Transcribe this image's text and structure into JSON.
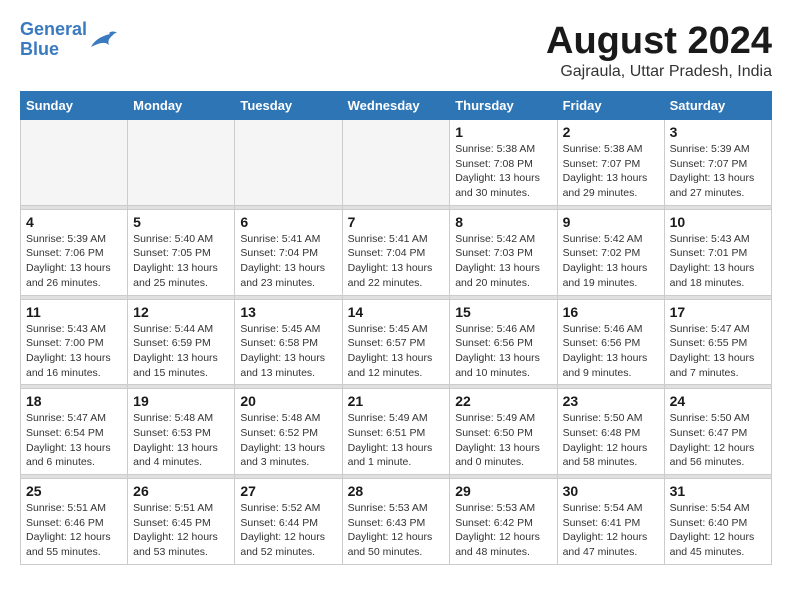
{
  "header": {
    "logo_line1": "General",
    "logo_line2": "Blue",
    "month_year": "August 2024",
    "location": "Gajraula, Uttar Pradesh, India"
  },
  "weekdays": [
    "Sunday",
    "Monday",
    "Tuesday",
    "Wednesday",
    "Thursday",
    "Friday",
    "Saturday"
  ],
  "weeks": [
    [
      {
        "day": "",
        "info": ""
      },
      {
        "day": "",
        "info": ""
      },
      {
        "day": "",
        "info": ""
      },
      {
        "day": "",
        "info": ""
      },
      {
        "day": "1",
        "info": "Sunrise: 5:38 AM\nSunset: 7:08 PM\nDaylight: 13 hours\nand 30 minutes."
      },
      {
        "day": "2",
        "info": "Sunrise: 5:38 AM\nSunset: 7:07 PM\nDaylight: 13 hours\nand 29 minutes."
      },
      {
        "day": "3",
        "info": "Sunrise: 5:39 AM\nSunset: 7:07 PM\nDaylight: 13 hours\nand 27 minutes."
      }
    ],
    [
      {
        "day": "4",
        "info": "Sunrise: 5:39 AM\nSunset: 7:06 PM\nDaylight: 13 hours\nand 26 minutes."
      },
      {
        "day": "5",
        "info": "Sunrise: 5:40 AM\nSunset: 7:05 PM\nDaylight: 13 hours\nand 25 minutes."
      },
      {
        "day": "6",
        "info": "Sunrise: 5:41 AM\nSunset: 7:04 PM\nDaylight: 13 hours\nand 23 minutes."
      },
      {
        "day": "7",
        "info": "Sunrise: 5:41 AM\nSunset: 7:04 PM\nDaylight: 13 hours\nand 22 minutes."
      },
      {
        "day": "8",
        "info": "Sunrise: 5:42 AM\nSunset: 7:03 PM\nDaylight: 13 hours\nand 20 minutes."
      },
      {
        "day": "9",
        "info": "Sunrise: 5:42 AM\nSunset: 7:02 PM\nDaylight: 13 hours\nand 19 minutes."
      },
      {
        "day": "10",
        "info": "Sunrise: 5:43 AM\nSunset: 7:01 PM\nDaylight: 13 hours\nand 18 minutes."
      }
    ],
    [
      {
        "day": "11",
        "info": "Sunrise: 5:43 AM\nSunset: 7:00 PM\nDaylight: 13 hours\nand 16 minutes."
      },
      {
        "day": "12",
        "info": "Sunrise: 5:44 AM\nSunset: 6:59 PM\nDaylight: 13 hours\nand 15 minutes."
      },
      {
        "day": "13",
        "info": "Sunrise: 5:45 AM\nSunset: 6:58 PM\nDaylight: 13 hours\nand 13 minutes."
      },
      {
        "day": "14",
        "info": "Sunrise: 5:45 AM\nSunset: 6:57 PM\nDaylight: 13 hours\nand 12 minutes."
      },
      {
        "day": "15",
        "info": "Sunrise: 5:46 AM\nSunset: 6:56 PM\nDaylight: 13 hours\nand 10 minutes."
      },
      {
        "day": "16",
        "info": "Sunrise: 5:46 AM\nSunset: 6:56 PM\nDaylight: 13 hours\nand 9 minutes."
      },
      {
        "day": "17",
        "info": "Sunrise: 5:47 AM\nSunset: 6:55 PM\nDaylight: 13 hours\nand 7 minutes."
      }
    ],
    [
      {
        "day": "18",
        "info": "Sunrise: 5:47 AM\nSunset: 6:54 PM\nDaylight: 13 hours\nand 6 minutes."
      },
      {
        "day": "19",
        "info": "Sunrise: 5:48 AM\nSunset: 6:53 PM\nDaylight: 13 hours\nand 4 minutes."
      },
      {
        "day": "20",
        "info": "Sunrise: 5:48 AM\nSunset: 6:52 PM\nDaylight: 13 hours\nand 3 minutes."
      },
      {
        "day": "21",
        "info": "Sunrise: 5:49 AM\nSunset: 6:51 PM\nDaylight: 13 hours\nand 1 minute."
      },
      {
        "day": "22",
        "info": "Sunrise: 5:49 AM\nSunset: 6:50 PM\nDaylight: 13 hours\nand 0 minutes."
      },
      {
        "day": "23",
        "info": "Sunrise: 5:50 AM\nSunset: 6:48 PM\nDaylight: 12 hours\nand 58 minutes."
      },
      {
        "day": "24",
        "info": "Sunrise: 5:50 AM\nSunset: 6:47 PM\nDaylight: 12 hours\nand 56 minutes."
      }
    ],
    [
      {
        "day": "25",
        "info": "Sunrise: 5:51 AM\nSunset: 6:46 PM\nDaylight: 12 hours\nand 55 minutes."
      },
      {
        "day": "26",
        "info": "Sunrise: 5:51 AM\nSunset: 6:45 PM\nDaylight: 12 hours\nand 53 minutes."
      },
      {
        "day": "27",
        "info": "Sunrise: 5:52 AM\nSunset: 6:44 PM\nDaylight: 12 hours\nand 52 minutes."
      },
      {
        "day": "28",
        "info": "Sunrise: 5:53 AM\nSunset: 6:43 PM\nDaylight: 12 hours\nand 50 minutes."
      },
      {
        "day": "29",
        "info": "Sunrise: 5:53 AM\nSunset: 6:42 PM\nDaylight: 12 hours\nand 48 minutes."
      },
      {
        "day": "30",
        "info": "Sunrise: 5:54 AM\nSunset: 6:41 PM\nDaylight: 12 hours\nand 47 minutes."
      },
      {
        "day": "31",
        "info": "Sunrise: 5:54 AM\nSunset: 6:40 PM\nDaylight: 12 hours\nand 45 minutes."
      }
    ]
  ]
}
